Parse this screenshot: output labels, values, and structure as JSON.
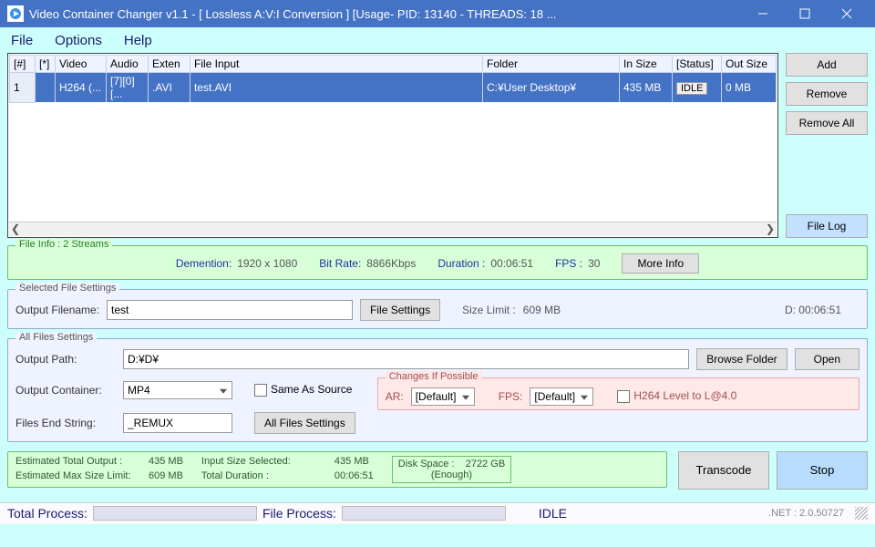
{
  "window": {
    "title": "Video Container Changer v1.1 - [ Lossless A:V:I Conversion ] [Usage- PID: 13140 - THREADS: 18 ..."
  },
  "menu": {
    "file": "File",
    "options": "Options",
    "help": "Help"
  },
  "grid": {
    "headers": {
      "idx": "[#]",
      "star": "[*]",
      "video": "Video",
      "audio": "Audio",
      "exten": "Exten",
      "file_input": "File Input",
      "folder": "Folder",
      "in_size": "In Size",
      "status": "[Status]",
      "out_size": "Out Size"
    },
    "row": {
      "idx": "1",
      "star": "",
      "video": "H264 (...",
      "audio": "[7][0][...",
      "exten": ".AVI",
      "file_input": "test.AVI",
      "folder": "C:¥User             Desktop¥",
      "in_size": "435 MB",
      "status": "IDLE",
      "out_size": "0 MB"
    }
  },
  "rightbtns": {
    "add": "Add",
    "remove": "Remove",
    "remove_all": "Remove All",
    "file_log": "File Log"
  },
  "fileinfo": {
    "legend": "File Info : 2 Streams",
    "dim_lbl": "Demention:",
    "dim": "1920 x 1080",
    "br_lbl": "Bit Rate:",
    "br": "8866Kbps",
    "dur_lbl": "Duration :",
    "dur": "00:06:51",
    "fps_lbl": "FPS :",
    "fps": "30",
    "more": "More Info"
  },
  "selected": {
    "legend": "Selected File Settings",
    "of_lbl": "Output Filename:",
    "of_val": "test",
    "fsettings": "File Settings",
    "size_lbl": "Size Limit :",
    "size_val": "609 MB",
    "d_lbl": "D: 00:06:51"
  },
  "allfiles": {
    "legend": "All Files Settings",
    "op_lbl": "Output Path:",
    "op_val": "D:¥D¥",
    "browse": "Browse Folder",
    "open": "Open",
    "oc_lbl": "Output Container:",
    "oc_val": "MP4",
    "same_as": "Same As Source",
    "afs": "All Files Settings",
    "fes_lbl": "Files End String:",
    "fes_val": "_REMUX",
    "changes": {
      "legend": "Changes If Possible",
      "ar_lbl": "AR:",
      "ar_val": "[Default]",
      "fps_lbl": "FPS:",
      "fps_val": "[Default]",
      "h264": "H264 Level to L@4.0"
    }
  },
  "stats": {
    "eto_lbl": "Estimated Total Output :",
    "eto": "435 MB",
    "ems_lbl": "Estimated Max Size Limit:",
    "ems": "609 MB",
    "iss_lbl": "Input Size Selected:",
    "iss": "435 MB",
    "td_lbl": "Total Duration :",
    "td": "00:06:51",
    "disk_lbl": "Disk Space :",
    "disk_val": "2722 GB",
    "disk_note": "(Enough)",
    "transcode": "Transcode",
    "stop": "Stop"
  },
  "status": {
    "tp": "Total Process:",
    "fp": "File Process:",
    "state": "IDLE",
    "net": ".NET :  2.0.50727"
  }
}
